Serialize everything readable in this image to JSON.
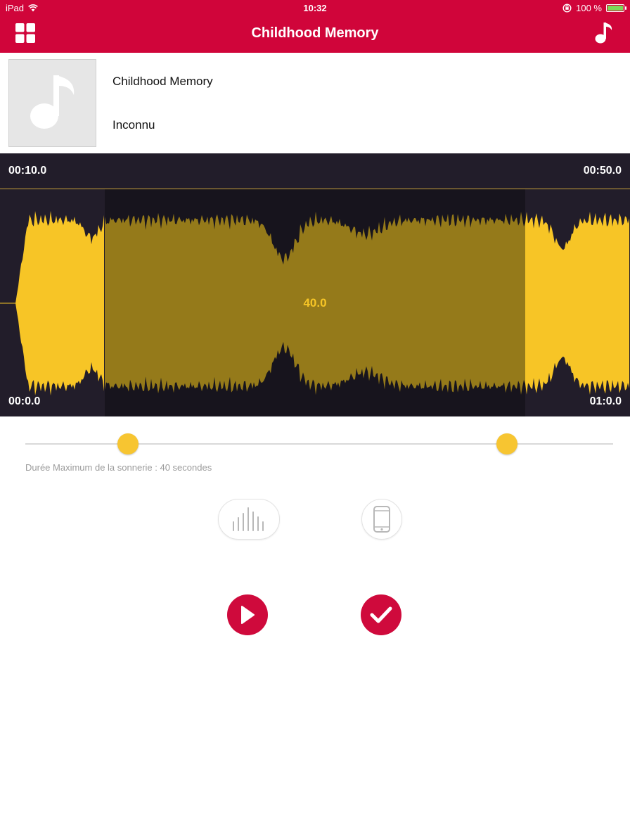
{
  "status_bar": {
    "device": "iPad",
    "time": "10:32",
    "battery": "100 %"
  },
  "nav": {
    "title": "Childhood Memory",
    "left_icon": "grid-icon",
    "right_icon": "music-note-icon"
  },
  "track": {
    "title": "Childhood Memory",
    "artist": "Inconnu",
    "artwork_icon": "music-note-icon"
  },
  "waveform": {
    "selection_start": "00:10.0",
    "selection_end": "00:50.0",
    "track_start": "00:0.0",
    "track_end": "01:0.0",
    "selection_duration": "40.0",
    "selection_start_seconds": 10,
    "selection_end_seconds": 50,
    "total_seconds": 60,
    "wave_color": "#f7c526",
    "selected_wave_color": "#957a1a",
    "background_color": "#221d2a"
  },
  "slider": {
    "start_fraction": 0.175,
    "end_fraction": 0.819
  },
  "hint": "Durée Maximum de la sonnerie : 40 secondes",
  "mode_buttons": {
    "wave_icon": "waveform-icon",
    "phone_icon": "phone-icon"
  },
  "actions": {
    "play_icon": "play-icon",
    "confirm_icon": "checkmark-icon"
  },
  "colors": {
    "accent": "#d0053a",
    "knob": "#f7c531"
  }
}
